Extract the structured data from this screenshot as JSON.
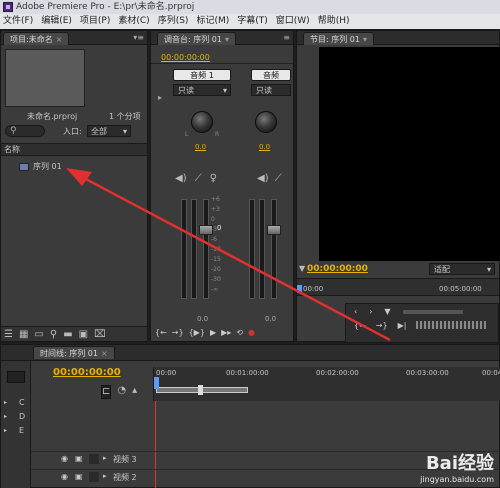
{
  "window": {
    "title": "Adobe Premiere Pro - E:\\pr\\未命名.prproj"
  },
  "menu": [
    "文件(F)",
    "编辑(E)",
    "项目(P)",
    "素材(C)",
    "序列(S)",
    "标记(M)",
    "字幕(T)",
    "窗口(W)",
    "帮助(H)"
  ],
  "project": {
    "tab": "项目:未命名",
    "filename": "未命名.prproj",
    "item_count": "1 个分项",
    "search_placeholder": "",
    "in_label": "入口:",
    "in_value": "全部",
    "column_name": "名称",
    "items": [
      "序列 01"
    ]
  },
  "mixer": {
    "tab": "调音台: 序列 01",
    "timecode": "00:00:00:00",
    "track1_label": "音频 1",
    "track2_label": "音频",
    "mode1": "只读",
    "mode2": "只读",
    "knob1_value": "0.0",
    "knob2_value": "0.0",
    "fader_value": "0",
    "fader_scale": [
      "+6",
      "+3",
      "0",
      "-3",
      "-6",
      "-10",
      "-15",
      "-20",
      "-30",
      "-∞"
    ],
    "bottom1": "0.0",
    "bottom2": "0.0"
  },
  "program": {
    "tab": "节目: 序列 01",
    "timecode": "00:00:00:00",
    "fit": "适配",
    "ruler_start": "00:00",
    "ruler_mid": "00:05:00:00"
  },
  "timeline": {
    "tab": "时间线: 序列 01",
    "timecode": "00:00:00:00",
    "ruler": [
      "00:00",
      "00:01:00:00",
      "00:02:00:00",
      "00:03:00:00",
      "00:04:0"
    ],
    "tracks": [
      "视频 3",
      "视频 2"
    ],
    "left_letters": [
      "C",
      "D",
      "E"
    ]
  },
  "watermark": {
    "brand": "Bai经验",
    "url": "jingyan.baidu.com"
  },
  "colors": {
    "accent": "#e8b200",
    "annotation": "#e03030"
  }
}
